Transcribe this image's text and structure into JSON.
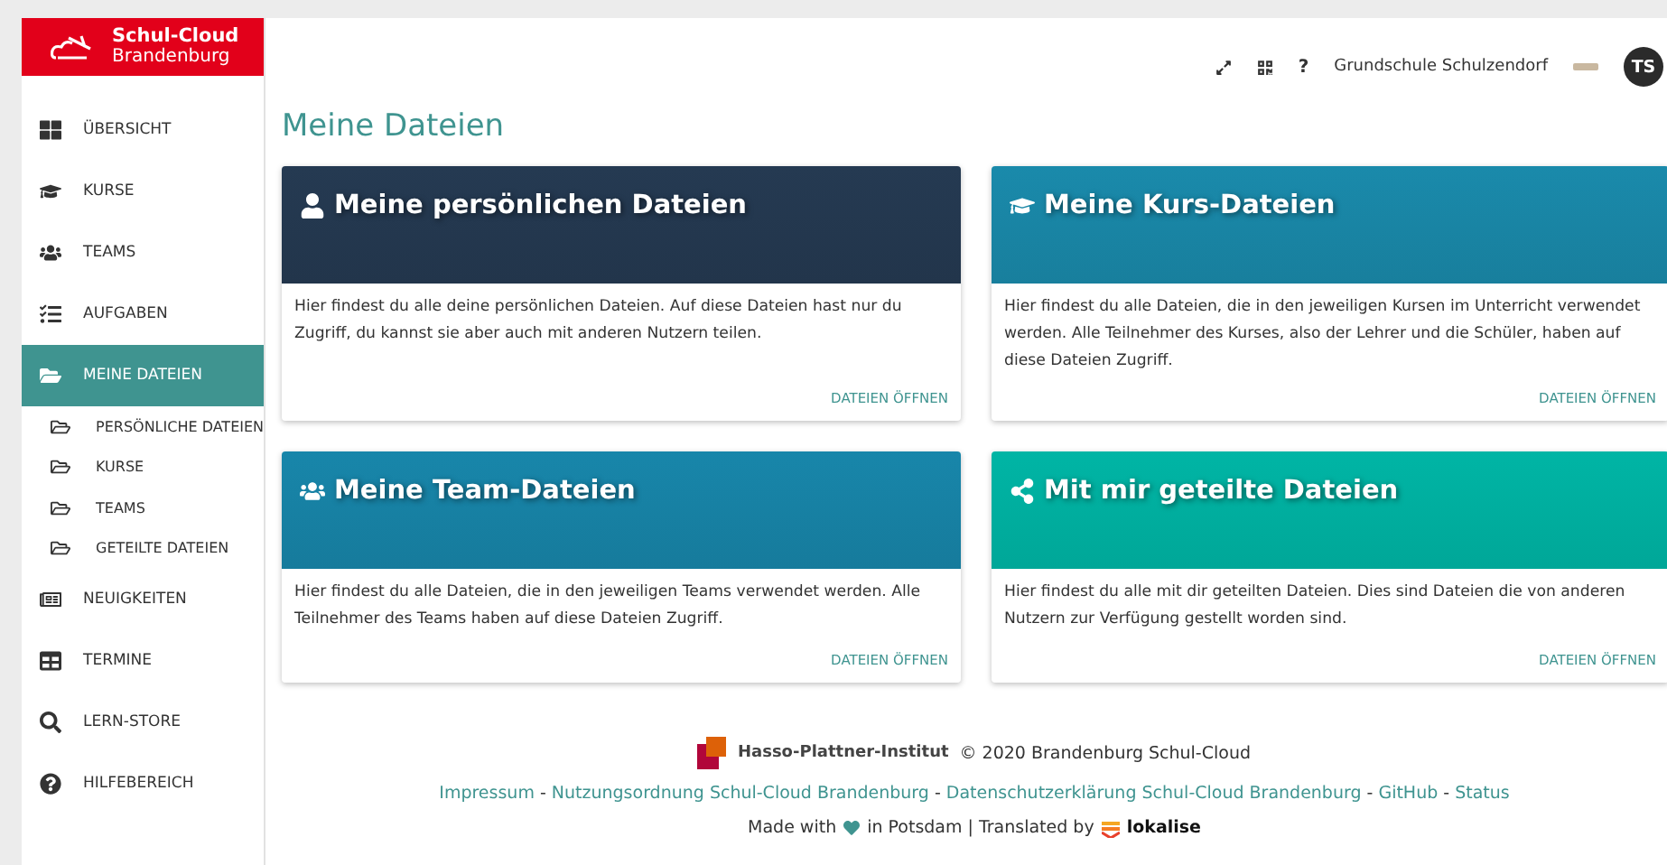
{
  "logo": {
    "title": "Schul-Cloud",
    "subtitle": "Brandenburg"
  },
  "sidebar": {
    "items": [
      {
        "label": "ÜBERSICHT",
        "selected": false
      },
      {
        "label": "KURSE",
        "selected": false
      },
      {
        "label": "TEAMS",
        "selected": false
      },
      {
        "label": "AUFGABEN",
        "selected": false
      },
      {
        "label": "MEINE DATEIEN",
        "selected": true,
        "children": [
          {
            "label": "PERSÖNLICHE DATEIEN",
            "selected": false
          },
          {
            "label": "KURSE",
            "selected": false
          },
          {
            "label": "TEAMS",
            "selected": false
          },
          {
            "label": "GETEILTE DATEIEN",
            "selected": false
          }
        ]
      },
      {
        "label": "NEUIGKEITEN",
        "selected": false
      },
      {
        "label": "TERMINE",
        "selected": false
      },
      {
        "label": "LERN-STORE",
        "selected": false
      },
      {
        "label": "HILFEBEREICH",
        "selected": false
      }
    ]
  },
  "header": {
    "help": "?",
    "school": "Grundschule Schulzendorf",
    "avatar": "TS"
  },
  "page_title": "Meine Dateien",
  "cards": [
    {
      "title": "Meine persönlichen Dateien",
      "color": "#253a52",
      "text": "Hier findest du alle deine persönlichen Dateien. Auf diese Dateien hast nur du Zugriff, du kannst sie aber auch mit anderen Nutzern teilen.",
      "link": "DATEIEN ÖFFNEN"
    },
    {
      "title": "Meine Kurs-Dateien",
      "color": "#1a8aab",
      "text": "Hier findest du alle Dateien, die in den jeweiligen Kursen im Unterricht verwendet werden. Alle Teilnehmer des Kurses, also der Lehrer und die Schüler, haben auf diese Dateien Zugriff.",
      "link": "DATEIEN ÖFFNEN"
    },
    {
      "title": "Meine Team-Dateien",
      "color": "#1886aa",
      "text": "Hier findest du alle Dateien, die in den jeweiligen Teams verwendet werden. Alle Teilnehmer des Teams haben auf diese Dateien Zugriff.",
      "link": "DATEIEN ÖFFNEN"
    },
    {
      "title": "Mit mir geteilte Dateien",
      "color": "#00b5a5",
      "text": "Hier findest du alle mit dir geteilten Dateien. Dies sind Dateien die von anderen Nutzern zur Verfügung gestellt worden sind.",
      "link": "DATEIEN ÖFFNEN"
    }
  ],
  "footer": {
    "institute": "Hasso-Plattner-Institut",
    "copyright": "© 2020 Brandenburg Schul-Cloud",
    "separator": "-",
    "links": [
      "Impressum",
      "Nutzungsordnung Schul-Cloud Brandenburg",
      "Datenschutzerklärung Schul-Cloud Brandenburg",
      "GitHub",
      "Status"
    ],
    "made_with": "Made with",
    "in_potsdam": "in Potsdam | Translated by",
    "lokalise": "lokalise"
  }
}
